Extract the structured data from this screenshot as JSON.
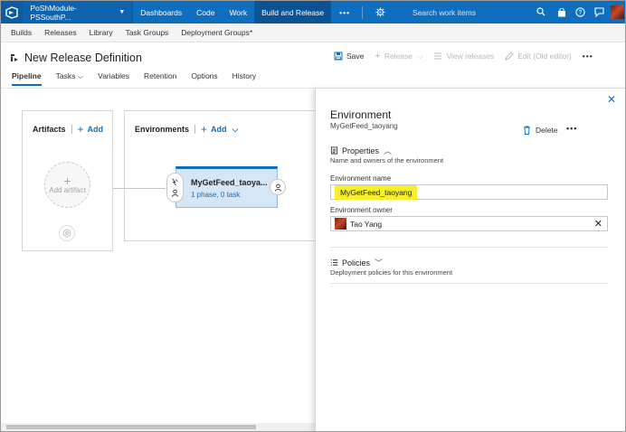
{
  "topbar": {
    "project": "PoShModule-PSSouthP...",
    "nav": [
      "Dashboards",
      "Code",
      "Work",
      "Build and Release"
    ],
    "more": "•••",
    "search_placeholder": "Search work items"
  },
  "subnav": {
    "items": [
      "Builds",
      "Releases",
      "Library",
      "Task Groups",
      "Deployment Groups*"
    ]
  },
  "page": {
    "title": "New Release Definition"
  },
  "toolbar": {
    "save": "Save",
    "release": "Release",
    "view_releases": "View releases",
    "edit": "Edit (Old editor)",
    "more": "•••"
  },
  "tabs": [
    "Pipeline",
    "Tasks",
    "Variables",
    "Retention",
    "Options",
    "History"
  ],
  "pipeline": {
    "artifacts_label": "Artifacts",
    "add_label": "Add",
    "add_artifact": "Add artifact",
    "environments_label": "Environments",
    "environment": {
      "name": "MyGetFeed_taoya...",
      "summary": "1 phase, 0 task"
    }
  },
  "panel": {
    "title": "Environment",
    "subtitle": "MyGetFeed_taoyang",
    "delete": "Delete",
    "more": "•••",
    "properties": {
      "title": "Properties",
      "description": "Name and owners of the environment"
    },
    "env_name_label": "Environment name",
    "env_name_value": "MyGetFeed_taoyang",
    "env_owner_label": "Environment owner",
    "env_owner_value": "Tao Yang",
    "policies": {
      "title": "Policies",
      "description": "Deployment policies for this environment"
    }
  },
  "colors": {
    "accent": "#106ebe",
    "highlight": "#f6ef2b"
  }
}
